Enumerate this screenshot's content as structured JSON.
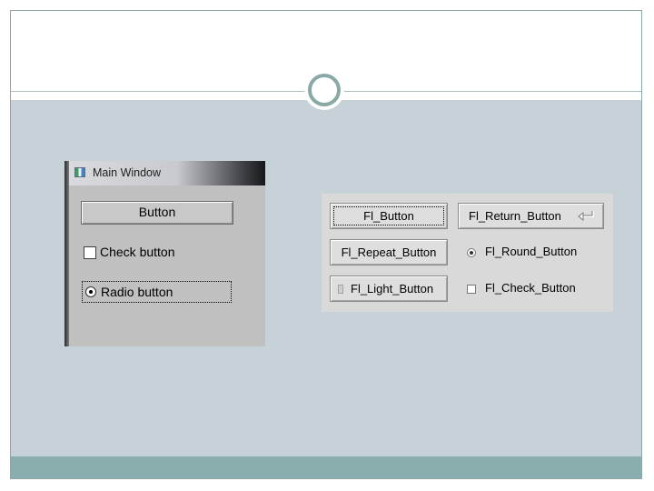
{
  "main_window": {
    "title": "Main Window",
    "button_label": "Button",
    "check_label": "Check button",
    "radio_label": "Radio button"
  },
  "fltk_buttons": {
    "button": "Fl_Button",
    "return_button": "Fl_Return_Button",
    "repeat_button": "Fl_Repeat_Button",
    "round_button": "Fl_Round_Button",
    "light_button": "Fl_Light_Button",
    "check_button": "Fl_Check_Button"
  },
  "colors": {
    "slide_body": "#c6d1d8",
    "slide_footer": "#8aaeae",
    "accent_ring": "#8aa8a6"
  }
}
